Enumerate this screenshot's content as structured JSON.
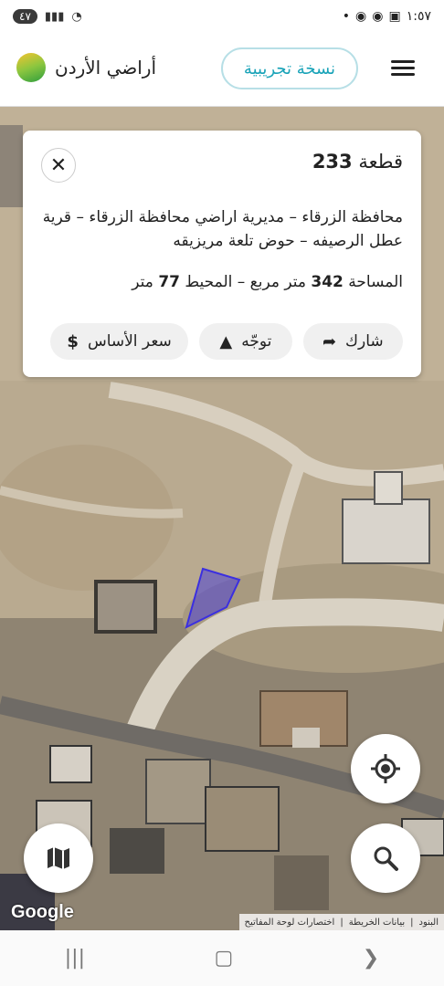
{
  "status_bar": {
    "battery": "٤٧",
    "time": "١:٥٧"
  },
  "header": {
    "trial_label": "نسخة تجريبية",
    "brand_name": "أراضي الأردن"
  },
  "card": {
    "title_prefix": "قطعة",
    "title_number": "233",
    "description": "محافظة الزرقاء – مديرية اراضي محافظة الزرقاء – قرية عطل الرصيفه – حوض تلعة مريزيقه",
    "area_label": "المساحة",
    "area_value": "342",
    "area_unit": "متر مربع – المحيط",
    "perimeter_value": "77",
    "perimeter_unit": "متر",
    "actions": [
      {
        "label": "شارك",
        "icon": "share-icon"
      },
      {
        "label": "توجّه",
        "icon": "navigate-icon"
      },
      {
        "label": "سعر الأساس",
        "icon": "dollar-icon"
      }
    ]
  },
  "map": {
    "google_label": "Google",
    "attribution": [
      "البنود",
      "بيانات الخريطة",
      "اختصارات لوحة المفاتيح"
    ],
    "parcel_color": "#4a3fd6"
  }
}
